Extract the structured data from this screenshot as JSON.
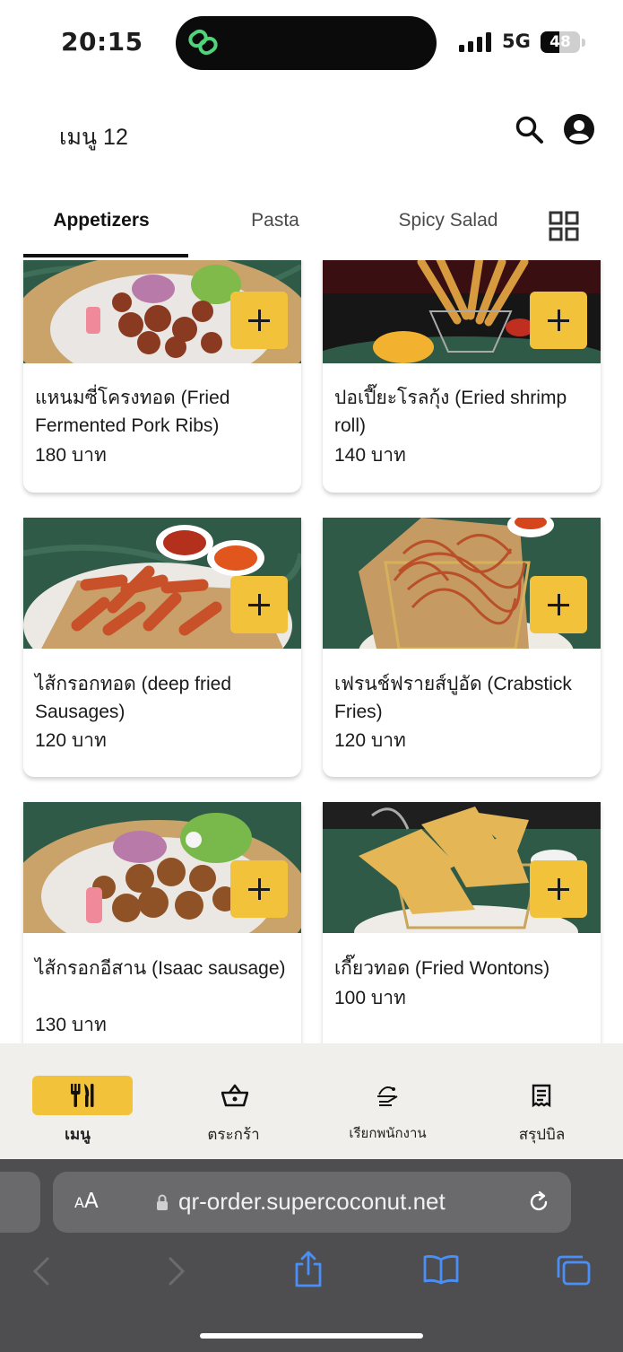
{
  "status_bar": {
    "time": "20:15",
    "network": "5G",
    "battery_level": "48",
    "battery_fraction": 0.48
  },
  "header": {
    "title": "เมนู 12"
  },
  "tabs": [
    {
      "label": "Appetizers",
      "active": true
    },
    {
      "label": "Pasta",
      "active": false
    },
    {
      "label": "Spicy Salad",
      "active": false
    }
  ],
  "items": [
    {
      "name": "แหนมซี่โครงทอด (Fried Fermented Pork Ribs)",
      "price": "180 บาท"
    },
    {
      "name": "ปอเปี๊ยะโรลกุ้ง (Eried shrimp roll)",
      "price": "140 บาท"
    },
    {
      "name": "ไส้กรอกทอด (deep fried Sausages)",
      "price": "120 บาท"
    },
    {
      "name": "เฟรนช์ฟรายส์ปูอัด (Crabstick Fries)",
      "price": "120 บาท"
    },
    {
      "name": "ไส้กรอกอีสาน (Isaac sausage)",
      "price": "130 บาท"
    },
    {
      "name": "เกี๊ยวทอด (Fried Wontons)",
      "price": "100 บาท"
    }
  ],
  "bottom_nav": [
    {
      "label": "เมนู",
      "icon": "utensils-icon",
      "active": true
    },
    {
      "label": "ตระกร้า",
      "icon": "basket-icon",
      "active": false
    },
    {
      "label": "เรียกพนักงาน",
      "icon": "call-staff-icon",
      "active": false
    },
    {
      "label": "สรุปบิล",
      "icon": "receipt-icon",
      "active": false
    }
  ],
  "browser": {
    "text_size_label": "AA",
    "url": "qr-order.supercoconut.net"
  },
  "colors": {
    "accent": "#f2c23a",
    "nav_background": "#f1efec",
    "browser_chrome": "#4e4e50",
    "marble_green": "#2f5a47"
  }
}
